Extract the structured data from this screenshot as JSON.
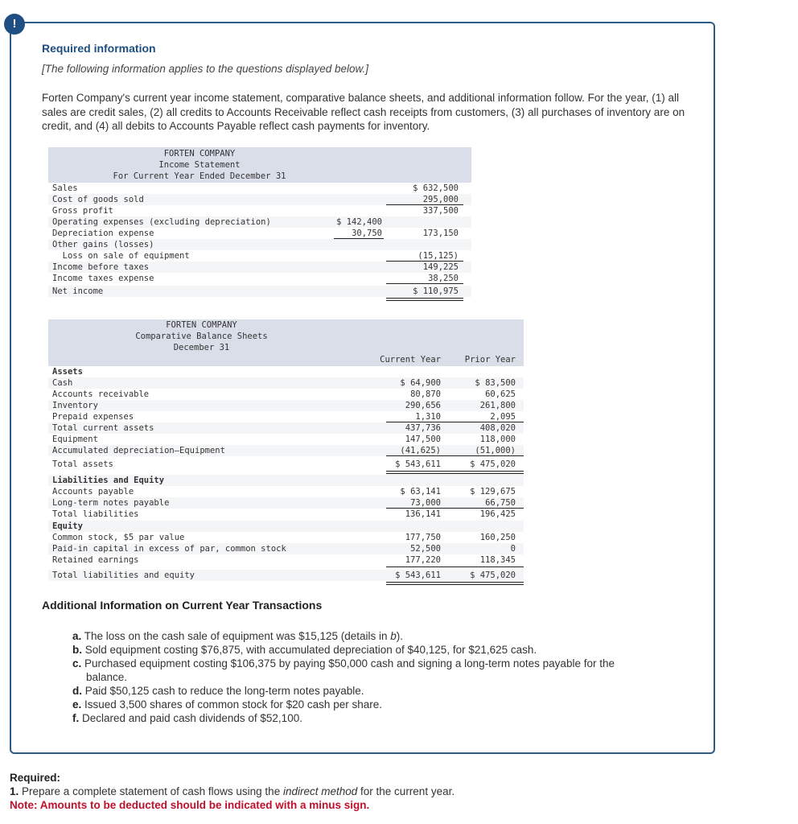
{
  "alert": {
    "icon": "exclamation-icon",
    "glyph": "!"
  },
  "header": {
    "title": "Required information",
    "subtitle": "[The following information applies to the questions displayed below.]",
    "intro": "Forten Company's current year income statement, comparative balance sheets, and additional information follow. For the year, (1) all sales are credit sales, (2) all credits to Accounts Receivable reflect cash receipts from customers, (3) all purchases of inventory are on credit, and (4) all debits to Accounts Payable reflect cash payments for inventory."
  },
  "income_statement": {
    "company": "FORTEN COMPANY",
    "title": "Income Statement",
    "period": "For Current Year Ended December 31",
    "rows": [
      {
        "label": "Sales",
        "col1": "",
        "col2": "$ 632,500"
      },
      {
        "label": "Cost of goods sold",
        "col1": "",
        "col2": "295,000"
      },
      {
        "label": "Gross profit",
        "col1": "",
        "col2": "337,500"
      },
      {
        "label": "Operating expenses (excluding depreciation)",
        "col1": "$ 142,400",
        "col2": ""
      },
      {
        "label": "Depreciation expense",
        "col1": "30,750",
        "col2": "173,150"
      },
      {
        "label": "Other gains (losses)",
        "col1": "",
        "col2": ""
      },
      {
        "label": "  Loss on sale of equipment",
        "col1": "",
        "col2": "(15,125)"
      },
      {
        "label": "Income before taxes",
        "col1": "",
        "col2": "149,225"
      },
      {
        "label": "Income taxes expense",
        "col1": "",
        "col2": "38,250"
      },
      {
        "label": "Net income",
        "col1": "",
        "col2": "$ 110,975"
      }
    ]
  },
  "balance_sheet": {
    "company": "FORTEN COMPANY",
    "title": "Comparative Balance Sheets",
    "date": "December 31",
    "col_current": "Current Year",
    "col_prior": "Prior Year",
    "rows": [
      {
        "label": "Assets",
        "current": "",
        "prior": "",
        "bold": true
      },
      {
        "label": "Cash",
        "current": "$ 64,900",
        "prior": "$ 83,500"
      },
      {
        "label": "Accounts receivable",
        "current": "80,870",
        "prior": "60,625"
      },
      {
        "label": "Inventory",
        "current": "290,656",
        "prior": "261,800"
      },
      {
        "label": "Prepaid expenses",
        "current": "1,310",
        "prior": "2,095"
      },
      {
        "label": "Total current assets",
        "current": "437,736",
        "prior": "408,020"
      },
      {
        "label": "Equipment",
        "current": "147,500",
        "prior": "118,000"
      },
      {
        "label": "Accumulated depreciation—Equipment",
        "current": "(41,625)",
        "prior": "(51,000)"
      },
      {
        "label": "Total assets",
        "current": "$ 543,611",
        "prior": "$ 475,020"
      },
      {
        "label": "Liabilities and Equity",
        "current": "",
        "prior": "",
        "bold": true
      },
      {
        "label": "Accounts payable",
        "current": "$ 63,141",
        "prior": "$ 129,675"
      },
      {
        "label": "Long-term notes payable",
        "current": "73,000",
        "prior": "66,750"
      },
      {
        "label": "Total liabilities",
        "current": "136,141",
        "prior": "196,425"
      },
      {
        "label": "Equity",
        "current": "",
        "prior": "",
        "bold": true
      },
      {
        "label": "Common stock, $5 par value",
        "current": "177,750",
        "prior": "160,250"
      },
      {
        "label": "Paid-in capital in excess of par, common stock",
        "current": "52,500",
        "prior": "0"
      },
      {
        "label": "Retained earnings",
        "current": "177,220",
        "prior": "118,345"
      },
      {
        "label": "Total liabilities and equity",
        "current": "$ 543,611",
        "prior": "$ 475,020"
      }
    ]
  },
  "additional_info": {
    "title": "Additional Information on Current Year Transactions",
    "items": [
      {
        "key": "a.",
        "text": "The loss on the cash sale of equipment was $15,125 (details in ",
        "emph": "b",
        "tail": ")."
      },
      {
        "key": "b.",
        "text": "Sold equipment costing $76,875, with accumulated depreciation of $40,125, for $21,625 cash."
      },
      {
        "key": "c.",
        "text": "Purchased equipment costing $106,375 by paying $50,000 cash and signing a long-term notes payable for the",
        "cont": "balance."
      },
      {
        "key": "d.",
        "text": "Paid $50,125 cash to reduce the long-term notes payable."
      },
      {
        "key": "e.",
        "text": "Issued 3,500 shares of common stock for $20 cash per share."
      },
      {
        "key": "f.",
        "text": "Declared and paid cash dividends of $52,100."
      }
    ]
  },
  "required": {
    "title": "Required:",
    "item_num": "1.",
    "item_pre": "Prepare a complete statement of cash flows using the ",
    "item_emph": "indirect method",
    "item_post": " for the current year.",
    "note": "Note: Amounts to be deducted should be indicated with a minus sign."
  },
  "colors": {
    "accent": "#1f4e82",
    "panel_border": "#2d5b8a",
    "table_header_bg": "#d9dee8",
    "row_shade": "#f4f5f7",
    "note_red": "#c0102b"
  }
}
